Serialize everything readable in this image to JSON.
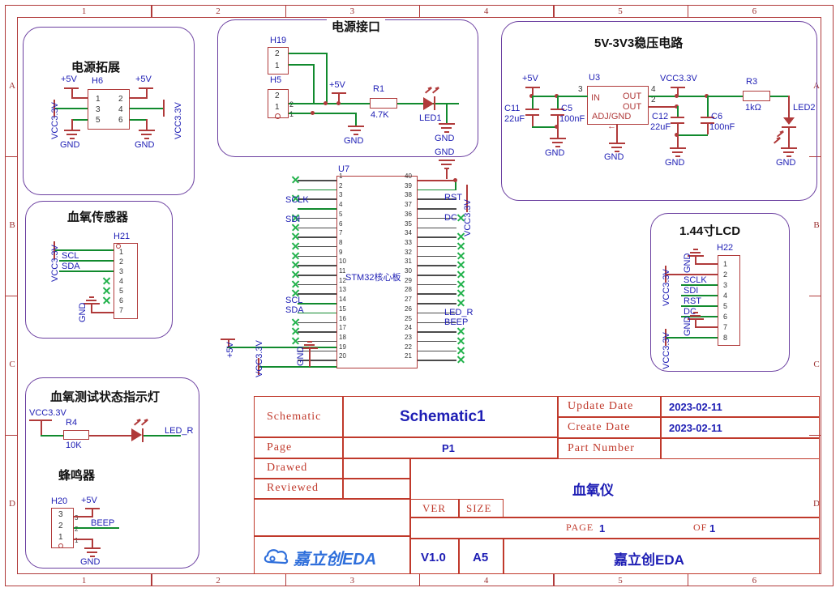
{
  "sheet": {
    "columns": [
      "1",
      "2",
      "3",
      "4",
      "5",
      "6"
    ],
    "rows": [
      "A",
      "B",
      "C",
      "D"
    ]
  },
  "blocks": {
    "power_expand": {
      "title": "电源拓展",
      "designator": "H6",
      "pins_left": [
        "1",
        "3",
        "5"
      ],
      "pins_right": [
        "2",
        "4",
        "6"
      ],
      "net_left_top": "+5V",
      "net_right_top": "+5V",
      "net_left_mid": "VCC3.3V",
      "net_right_mid": "VCC3.3V",
      "gnd_left": "GND",
      "gnd_right": "GND"
    },
    "power_interface": {
      "title": "电源接口",
      "h19": "H19",
      "h19_pins": [
        "2",
        "1"
      ],
      "h5": "H5",
      "h5_pins": [
        "2",
        "1"
      ],
      "h5_pin_labels": [
        "2",
        "1"
      ],
      "net_5v": "+5V",
      "gnd": "GND",
      "r1_name": "R1",
      "r1_value": "4.7K",
      "led1": "LED1",
      "led1_gnd": "GND",
      "gnd_below": "GND"
    },
    "regulator": {
      "title": "5V-3V3稳压电路",
      "u3": "U3",
      "in_label": "IN",
      "out_label_1": "OUT",
      "out_label_2": "OUT",
      "adj_label": "ADJ/GND",
      "pin_in": "3",
      "pin_out1": "4",
      "pin_out2": "2",
      "net_5v": "+5V",
      "net_vcc": "VCC3.3V",
      "c11_name": "C11",
      "c11_value": "22uF",
      "c5_name": "C5",
      "c5_value": "100nF",
      "c12_name": "C12",
      "c12_value": "22uF",
      "c6_name": "C6",
      "c6_value": "100nF",
      "r3_name": "R3",
      "r3_value": "1kΩ",
      "led2": "LED2",
      "gnds": [
        "GND",
        "GND",
        "GND",
        "GND"
      ]
    },
    "spo2_sensor": {
      "title": "血氧传感器",
      "designator": "H21",
      "pins": [
        "1",
        "2",
        "3",
        "4",
        "5",
        "6",
        "7"
      ],
      "net_vcc": "VCC3.3V",
      "net_scl": "SCL",
      "net_sda": "SDA",
      "net_gnd": "GND"
    },
    "status_led": {
      "title": "血氧测试状态指示灯",
      "net_vcc": "VCC3.3V",
      "r4_name": "R4",
      "r4_value": "10K",
      "led_net": "LED_R"
    },
    "buzzer": {
      "title": "蜂鸣器",
      "designator": "H20",
      "pins": [
        "3",
        "2",
        "1"
      ],
      "pin_labels": [
        "3",
        "2",
        "1"
      ],
      "net_5v": "+5V",
      "net_beep": "BEEP",
      "net_gnd": "GND"
    },
    "lcd": {
      "title": "1.44寸LCD",
      "designator": "H22",
      "pins": [
        "1",
        "2",
        "3",
        "4",
        "5",
        "6",
        "7",
        "8"
      ],
      "net_gnd_top": "GND",
      "net_vcc_top": "VCC3.3V",
      "net_sclk": "SCLK",
      "net_sdi": "SDI",
      "net_rst": "RST",
      "net_dc": "DC",
      "net_gnd_bot": "GND",
      "net_vcc_bot": "VCC3.3V"
    },
    "mcu": {
      "designator": "U7",
      "name": "STM32核心板",
      "left_pins": [
        "1",
        "2",
        "3",
        "4",
        "5",
        "6",
        "7",
        "8",
        "9",
        "10",
        "11",
        "12",
        "13",
        "14",
        "15",
        "16",
        "17",
        "18",
        "19",
        "20"
      ],
      "right_pins": [
        "40",
        "39",
        "38",
        "37",
        "36",
        "35",
        "34",
        "33",
        "32",
        "31",
        "30",
        "29",
        "28",
        "27",
        "26",
        "25",
        "24",
        "23",
        "22",
        "21"
      ],
      "left_nets": {
        "2": "SCLK",
        "4": "SDI",
        "14": "SCL",
        "15": "SDA"
      },
      "right_nets": {
        "37": "RST",
        "35": "DC",
        "26": "LED_R",
        "25": "BEEP"
      },
      "net_5v": "+5V",
      "net_vcc_left": "VCC3.3V",
      "net_gnd_left": "GND",
      "net_gnd_top": "GND",
      "net_vcc_right": "VCC3.3V"
    }
  },
  "title_block": {
    "schematic_label": "Schematic",
    "schematic_value": "Schematic1",
    "page_label": "Page",
    "page_value": "P1",
    "drawed_label": "Drawed",
    "drawed_value": "",
    "reviewed_label": "Reviewed",
    "reviewed_value": "",
    "update_date_label": "Update Date",
    "update_date_value": "2023-02-11",
    "create_date_label": "Create Date",
    "create_date_value": "2023-02-11",
    "part_number_label": "Part Number",
    "part_number_value": "",
    "project_title": "血氧仪",
    "page_no_label": "PAGE",
    "page_no_value": "1",
    "of_label": "OF",
    "of_value": "1",
    "ver_label": "VER",
    "ver_value": "V1.0",
    "size_label": "SIZE",
    "size_value": "A5",
    "company_logo": "嘉立创EDA",
    "company_name": "嘉立创EDA"
  },
  "colors": {
    "wire_green": "#118a2e",
    "part_red": "#b03a3a",
    "net_blue": "#1d1db4",
    "block_purple": "#6b3fa0",
    "frame_red": "#c0392b"
  }
}
